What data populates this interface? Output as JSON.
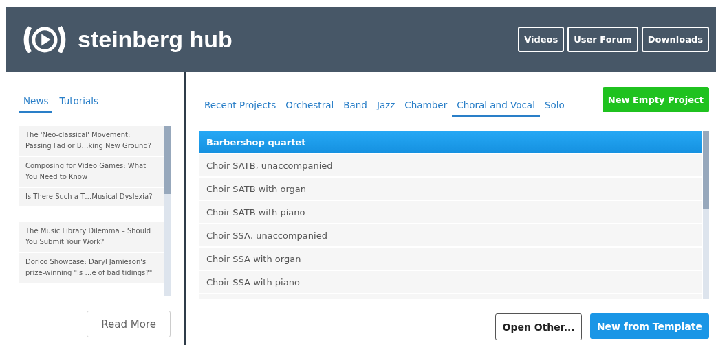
{
  "header": {
    "brand": "steinberg hub",
    "links": [
      "Videos",
      "User Forum",
      "Downloads"
    ]
  },
  "news_panel": {
    "tabs": [
      {
        "label": "News",
        "selected": true
      },
      {
        "label": "Tutorials",
        "selected": false
      }
    ],
    "articles": [
      {
        "title": "The 'Neo-classical' Movement: Passing Fad or B…king New Ground?"
      },
      {
        "title": "Composing for Video Games: What You Need to Know"
      },
      {
        "title": "Is There Such a T…Musical Dyslexia?"
      },
      {
        "kind": "gap"
      },
      {
        "title": "The Music Library Dilemma – Should You Submit Your Work?"
      },
      {
        "title": "Dorico Showcase: Daryl Jamieson's prize-winning \"Is …e of bad tidings?\""
      }
    ],
    "button": "Read More"
  },
  "projects_panel": {
    "tabs": [
      {
        "label": "Recent Projects",
        "selected": false
      },
      {
        "label": "Orchestral",
        "selected": false
      },
      {
        "label": "Band",
        "selected": false
      },
      {
        "label": "Jazz",
        "selected": false
      },
      {
        "label": "Chamber",
        "selected": false
      },
      {
        "label": "Choral and Vocal",
        "selected": true
      },
      {
        "label": "Solo",
        "selected": false
      }
    ],
    "new_empty_button": "New Empty Project",
    "templates": [
      {
        "name": "Barbershop quartet",
        "selected": true
      },
      {
        "name": "Choir SATB, unaccompanied",
        "selected": false
      },
      {
        "name": "Choir SATB with organ",
        "selected": false
      },
      {
        "name": "Choir SATB with piano",
        "selected": false
      },
      {
        "name": "Choir SSA, unaccompanied",
        "selected": false
      },
      {
        "name": "Choir SSA with organ",
        "selected": false
      },
      {
        "name": "Choir SSA with piano",
        "selected": false
      }
    ],
    "buttons": [
      {
        "label": "Open Other...",
        "kind": "secondary"
      },
      {
        "label": "New from Template",
        "kind": "primary"
      }
    ]
  }
}
